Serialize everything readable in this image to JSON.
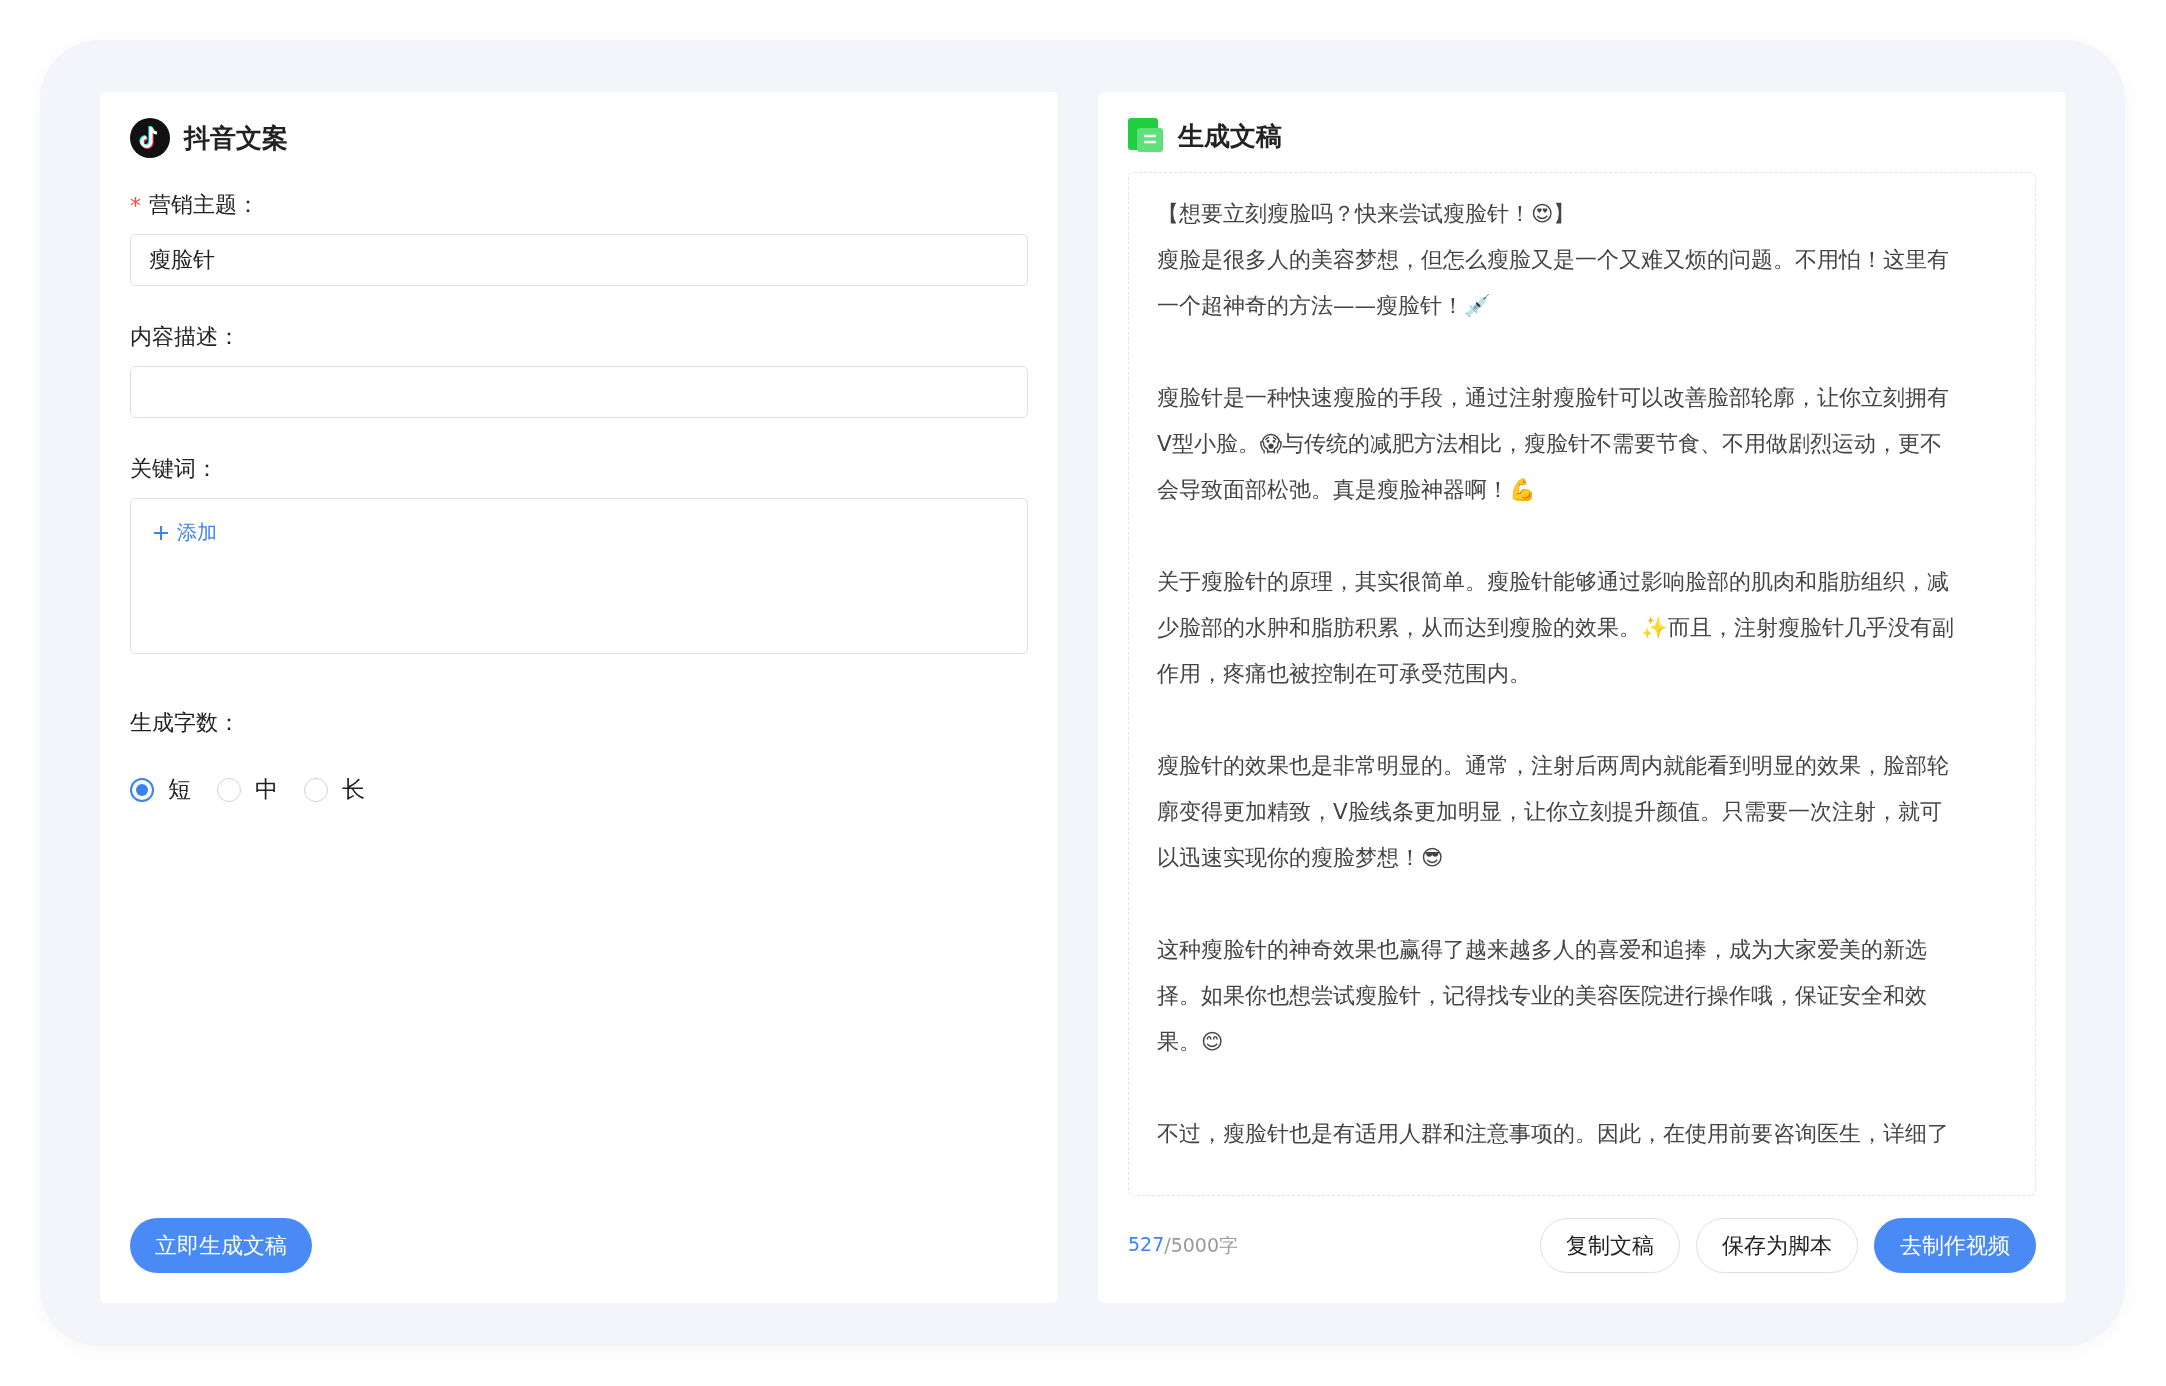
{
  "left": {
    "title": "抖音文案",
    "fields": [
      {
        "kind": "text",
        "label": "营销主题：",
        "required_mark": "*",
        "value": "瘦脸针"
      },
      {
        "kind": "text",
        "label": "内容描述："
      },
      {
        "kind": "tags",
        "label": "关键词：",
        "add_label": "添加"
      },
      {
        "kind": "radio",
        "label": "生成字数：",
        "options": [
          {
            "label": "短",
            "selected": true
          },
          {
            "label": "中",
            "selected": false
          },
          {
            "label": "长",
            "selected": false
          }
        ]
      }
    ],
    "submit": "立即生成文稿"
  },
  "right": {
    "title": "生成文稿",
    "paragraphs": [
      {
        "lines": [
          "【想要立刻瘦脸吗？快来尝试瘦脸针！😍】",
          "瘦脸是很多人的美容梦想，但怎么瘦脸又是一个又难又烦的问题。不用怕！这里有",
          "一个超神奇的方法——瘦脸针！💉"
        ]
      },
      {
        "lines": [
          "瘦脸针是一种快速瘦脸的手段，通过注射瘦脸针可以改善脸部轮廓，让你立刻拥有",
          "V型小脸。😱与传统的减肥方法相比，瘦脸针不需要节食、不用做剧烈运动，更不",
          "会导致面部松弛。真是瘦脸神器啊！💪"
        ]
      },
      {
        "lines": [
          "关于瘦脸针的原理，其实很简单。瘦脸针能够通过影响脸部的肌肉和脂肪组织，减",
          "少脸部的水肿和脂肪积累，从而达到瘦脸的效果。✨而且，注射瘦脸针几乎没有副",
          "作用，疼痛也被控制在可承受范围内。"
        ]
      },
      {
        "lines": [
          "瘦脸针的效果也是非常明显的。通常，注射后两周内就能看到明显的效果，脸部轮",
          "廓变得更加精致，V脸线条更加明显，让你立刻提升颜值。只需要一次注射，就可",
          "以迅速实现你的瘦脸梦想！😎"
        ]
      },
      {
        "lines": [
          "这种瘦脸针的神奇效果也赢得了越来越多人的喜爱和追捧，成为大家爱美的新选",
          "择。如果你也想尝试瘦脸针，记得找专业的美容医院进行操作哦，保证安全和效",
          "果。😊"
        ]
      },
      {
        "lines": [
          "不过，瘦脸针也是有适用人群和注意事项的。因此，在使用前要咨询医生，详细了"
        ]
      }
    ],
    "count": "527",
    "limit": "/5000字",
    "buttons": [
      {
        "kind": "secondary",
        "label": "复制文稿"
      },
      {
        "kind": "secondary",
        "label": "保存为脚本"
      },
      {
        "kind": "primary",
        "label": "去制作视频"
      }
    ]
  }
}
